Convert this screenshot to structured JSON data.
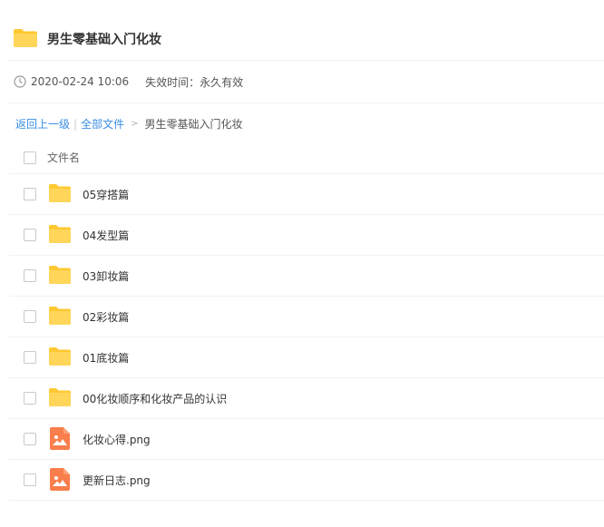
{
  "share": {
    "title": "男生零基础入门化妆",
    "date": "2020-02-24 10:06",
    "expire": "失效时间：永久有效"
  },
  "breadcrumb": {
    "back": "返回上一级",
    "sep": "|",
    "all": "全部文件",
    "arrow": ">",
    "current": "男生零基础入门化妆"
  },
  "list": {
    "header": "文件名",
    "rows": [
      {
        "name": "05穿搭篇",
        "type": "folder-icon"
      },
      {
        "name": "04发型篇",
        "type": "folder-icon"
      },
      {
        "name": "03卸妆篇",
        "type": "folder-icon"
      },
      {
        "name": "02彩妆篇",
        "type": "folder-icon"
      },
      {
        "name": "01底妆篇",
        "type": "folder-icon"
      },
      {
        "name": "00化妆顺序和化妆产品的认识",
        "type": "folder-icon"
      },
      {
        "name": "化妆心得.png",
        "type": "image-file-icon"
      },
      {
        "name": "更新日志.png",
        "type": "image-file-icon"
      }
    ]
  },
  "colors": {
    "folder": "#ffd659",
    "image_file": "#f97e4b",
    "link": "#3a8ee6"
  }
}
